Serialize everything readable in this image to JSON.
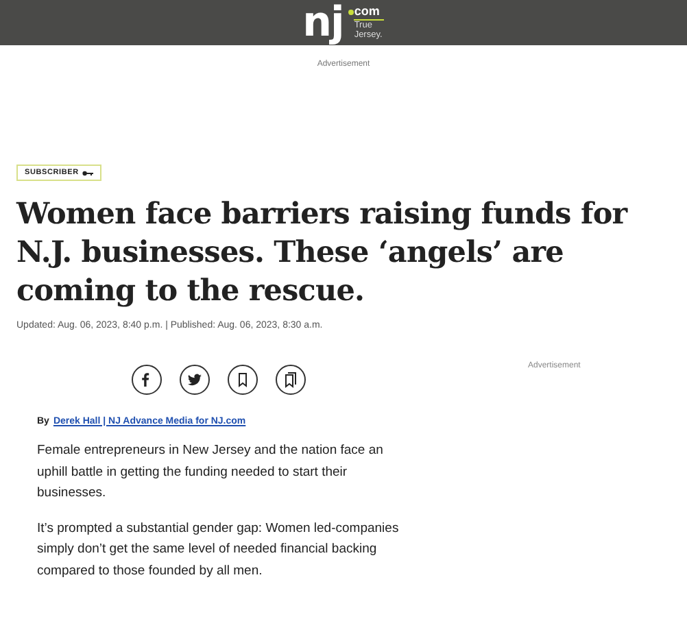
{
  "header": {
    "logo": {
      "mark": "nj",
      "domain": "com",
      "tagline": "True Jersey."
    }
  },
  "top_ad": "Advertisement",
  "badge": "SUBSCRIBER",
  "headline": "Women face barriers raising funds for N.J. businesses. These ‘angels’ are coming to the rescue.",
  "dateline": "Updated: Aug. 06, 2023, 8:40 p.m. | Published: Aug. 06, 2023, 8:30 a.m.",
  "share_buttons": [
    {
      "kind": "facebook"
    },
    {
      "kind": "twitter"
    },
    {
      "kind": "bookmark"
    },
    {
      "kind": "bookmarks"
    }
  ],
  "side_ad": "Advertisement",
  "byline": {
    "prefix": "By",
    "author": "Derek Hall | NJ Advance Media for NJ.com"
  },
  "paragraphs": [
    "Female entrepreneurs in New Jersey and the nation face an uphill battle in getting the funding needed to start their businesses.",
    "It’s prompted a substantial gender gap: Women led-companies simply don’t get the same level of needed financial backing compared to those founded by all men."
  ]
}
